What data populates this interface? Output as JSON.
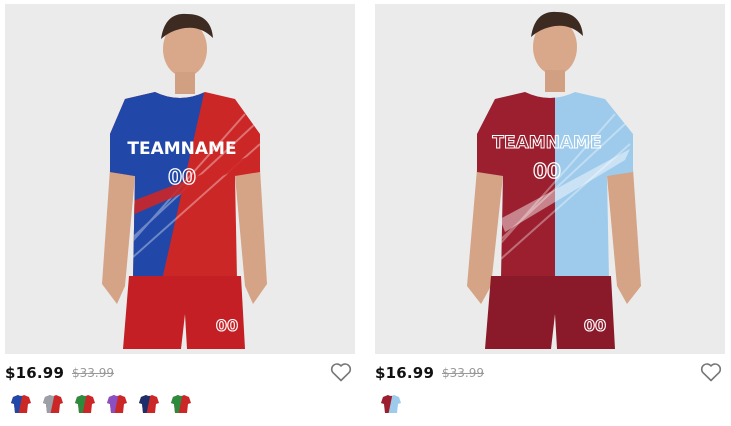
{
  "products": [
    {
      "price": "$16.99",
      "old_price": "$33.99",
      "jersey_text": "TEAMNAME",
      "jersey_number": "00",
      "shorts_number": "00",
      "colors": {
        "left": "#2148a8",
        "right": "#cc2727",
        "shorts": "#c41f24"
      },
      "swatches": [
        {
          "left": "#2148a8",
          "right": "#cc2727"
        },
        {
          "left": "#9aa0a8",
          "right": "#cc2727"
        },
        {
          "left": "#2e8b3e",
          "right": "#cc2727"
        },
        {
          "left": "#8a4fc0",
          "right": "#cc2727"
        },
        {
          "left": "#1d2f6b",
          "right": "#cc2727"
        },
        {
          "left": "#2e8b3e",
          "right": "#cc2727"
        }
      ]
    },
    {
      "price": "$16.99",
      "old_price": "$33.99",
      "jersey_text": "TEAMNAME",
      "jersey_number": "00",
      "shorts_number": "00",
      "colors": {
        "left": "#9b1f2e",
        "right": "#9ecbec",
        "shorts": "#8a1a2a"
      },
      "swatches": [
        {
          "left": "#9b1f2e",
          "right": "#9ecbec"
        }
      ]
    }
  ]
}
